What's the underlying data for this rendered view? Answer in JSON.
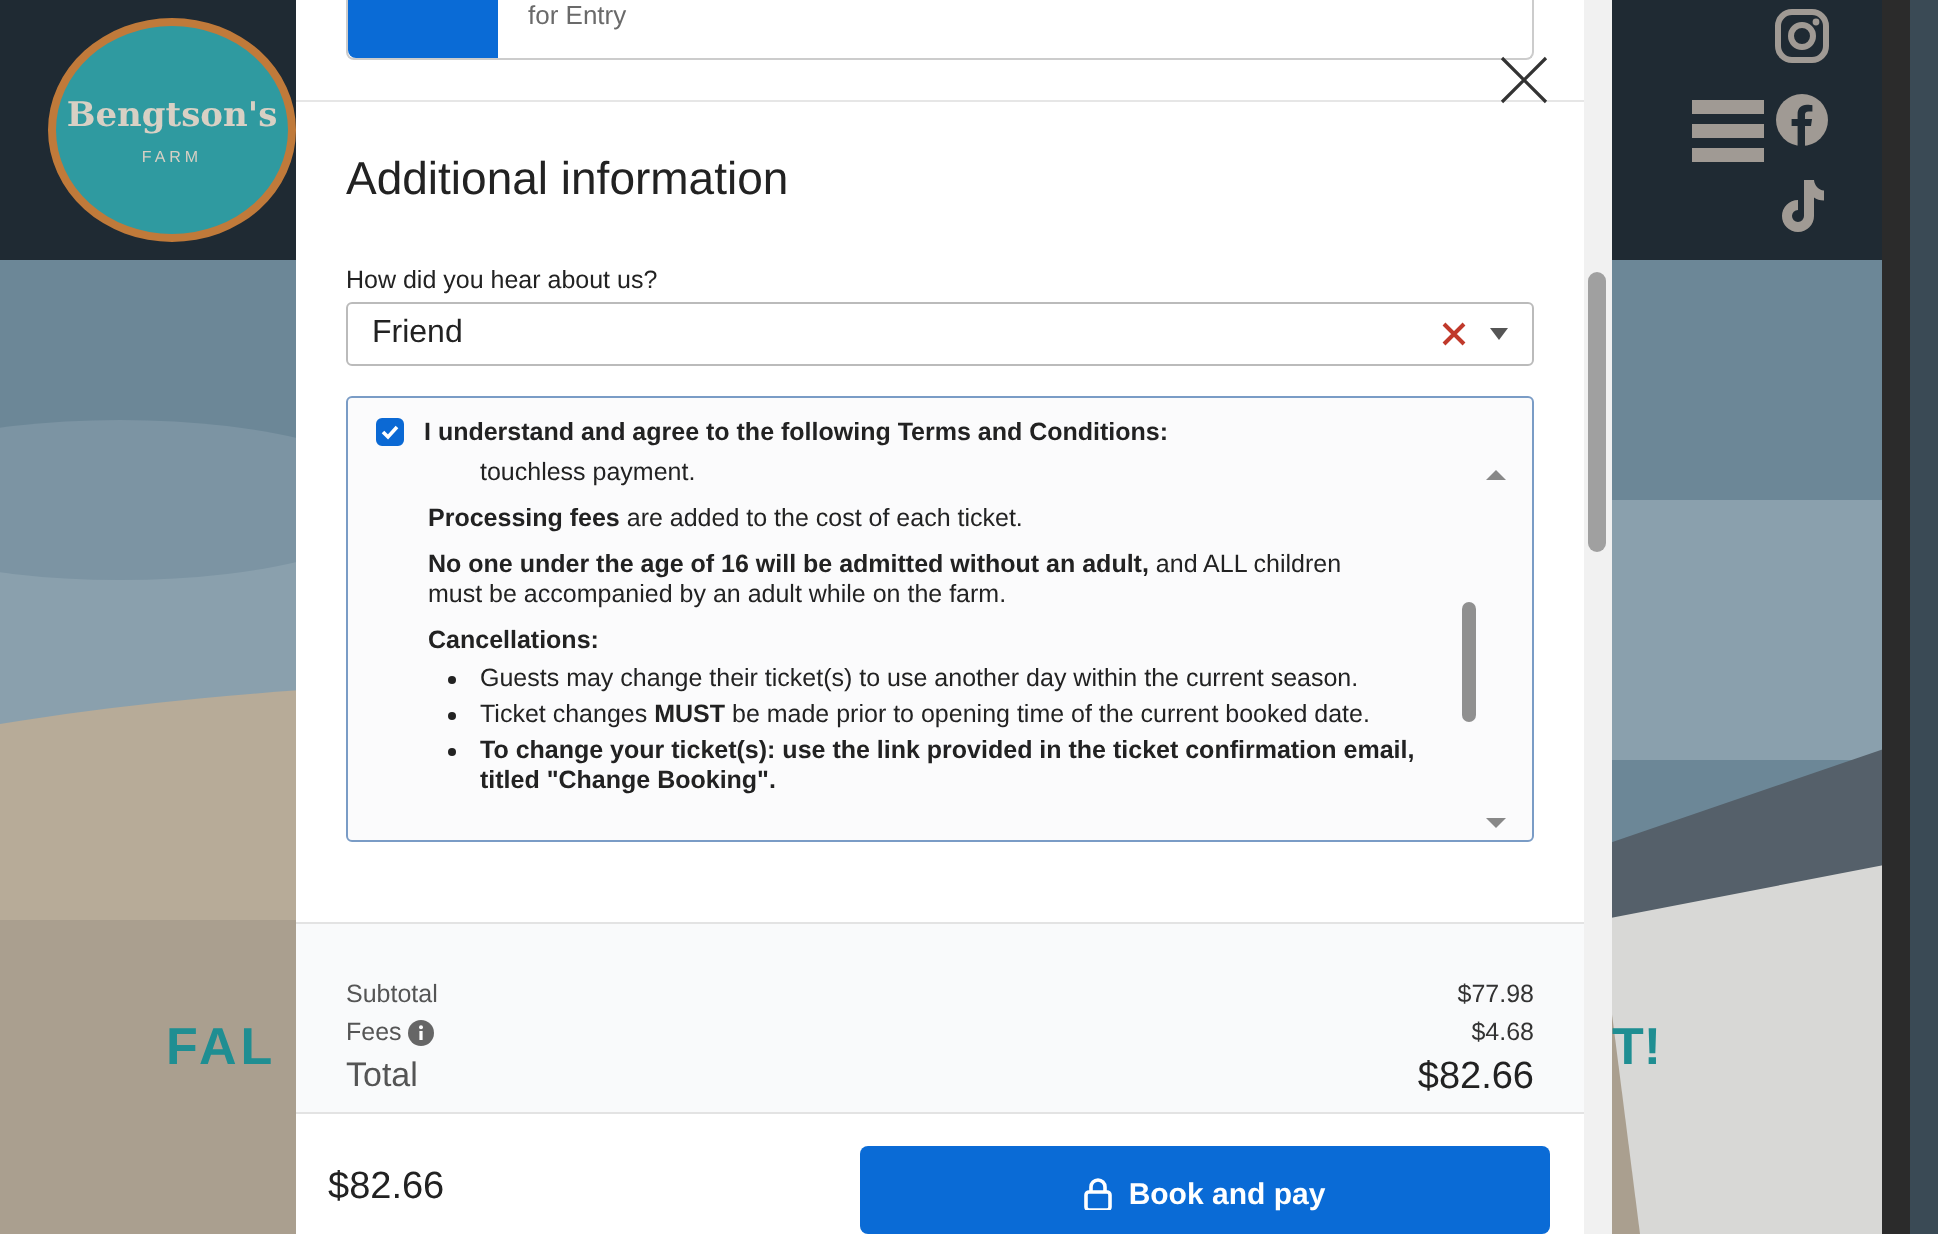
{
  "site": {
    "logo_name": "Bengtson's",
    "logo_sub": "FARM",
    "hero_left": "FAL",
    "hero_right": "T!"
  },
  "modal": {
    "ticket": {
      "description": "for Entry"
    },
    "heading": "Additional information",
    "question": {
      "label": "How did you hear about us?",
      "value": "Friend"
    },
    "terms": {
      "checked": true,
      "label": "I understand and agree to the following Terms and Conditions:",
      "blocks": [
        {
          "kind": "indent",
          "text": "touchless payment."
        },
        {
          "kind": "para",
          "text": "**Processing fees** are added to the cost of each ticket."
        },
        {
          "kind": "para",
          "text": "**No one under the age of 16 will be admitted without an adult,** and ALL children must be accompanied by an adult while on the farm."
        },
        {
          "kind": "heading",
          "text": "Cancellations:"
        },
        {
          "kind": "bullet",
          "text": "Guests may change their ticket(s) to use another day within the current season."
        },
        {
          "kind": "bullet",
          "text": "Ticket changes **MUST** be made prior to opening time of the current booked date."
        },
        {
          "kind": "bullet",
          "text": "**To change your ticket(s): use the link provided in the ticket confirmation email, titled \"Change Booking\".**"
        }
      ]
    },
    "summary": {
      "subtotal_label": "Subtotal",
      "subtotal": "$77.98",
      "fees_label": "Fees",
      "fees": "$4.68",
      "total_label": "Total",
      "total": "$82.66"
    },
    "footer": {
      "price": "$82.66",
      "button": "Book and pay"
    }
  }
}
